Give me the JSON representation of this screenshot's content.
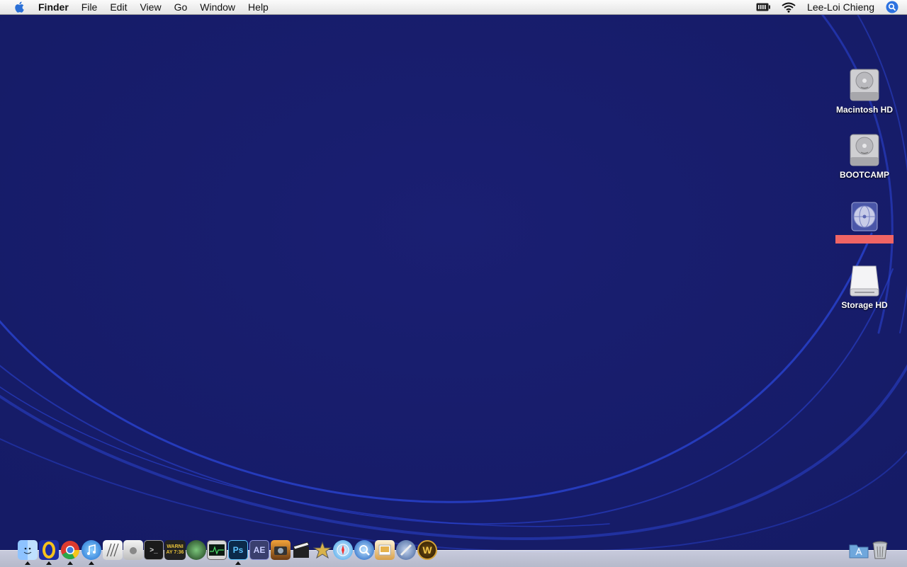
{
  "menubar": {
    "apple_icon": "apple-icon",
    "app_name": "Finder",
    "menus": [
      "File",
      "Edit",
      "View",
      "Go",
      "Window",
      "Help"
    ],
    "status_icons": [
      "battery-icon",
      "wifi-icon"
    ],
    "user_name": "Lee-Loi Chieng",
    "spotlight_icon": "spotlight-search-icon"
  },
  "desktop": {
    "wallpaper_color": "#181e6e",
    "icons": [
      {
        "label": "Macintosh HD",
        "icon": "hard-drive-icon"
      },
      {
        "label": "BOOTCAMP",
        "icon": "hard-drive-icon"
      },
      {
        "label": "",
        "icon": "network-disk-icon",
        "label_redacted": true
      },
      {
        "label": "Storage HD",
        "icon": "external-drive-icon"
      }
    ]
  },
  "dock": {
    "apps": [
      {
        "name": "finder-icon",
        "running": true
      },
      {
        "name": "adium-icon",
        "running": true
      },
      {
        "name": "chrome-icon",
        "running": true
      },
      {
        "name": "itunes-icon",
        "running": true
      },
      {
        "name": "script-editor-icon",
        "running": false
      },
      {
        "name": "boot-camp-icon",
        "running": false
      },
      {
        "name": "terminal-icon",
        "running": false
      },
      {
        "name": "console-icon",
        "running": false,
        "text": "WARNI AY 7:36"
      },
      {
        "name": "disk-utility-icon",
        "running": false
      },
      {
        "name": "activity-monitor-icon",
        "running": false
      },
      {
        "name": "photoshop-icon",
        "running": true,
        "text": "Ps"
      },
      {
        "name": "after-effects-icon",
        "running": false,
        "text": "AE"
      },
      {
        "name": "iphoto-icon",
        "running": false
      },
      {
        "name": "final-cut-icon",
        "running": false
      },
      {
        "name": "imovie-icon",
        "running": false
      },
      {
        "name": "safari-icon",
        "running": false
      },
      {
        "name": "quicktime-icon",
        "running": false
      },
      {
        "name": "preview-icon",
        "running": false
      },
      {
        "name": "xcode-icon",
        "running": false
      },
      {
        "name": "world-of-warcraft-icon",
        "running": false,
        "text": "W"
      }
    ],
    "right": [
      {
        "name": "applications-folder-icon"
      },
      {
        "name": "trash-icon"
      }
    ]
  }
}
